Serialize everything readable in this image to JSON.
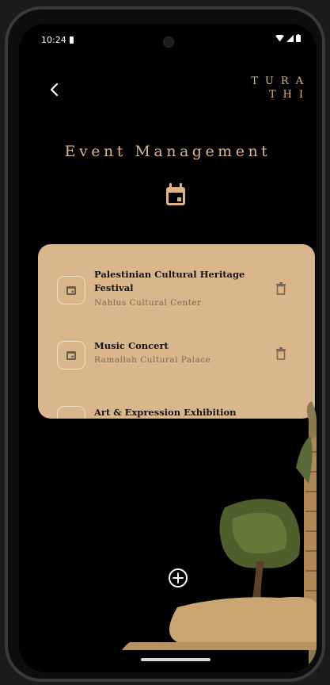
{
  "status_bar": {
    "time": "10:24"
  },
  "header": {
    "brand_line1": "TURA",
    "brand_line2": "THI"
  },
  "page": {
    "title": "Event Management"
  },
  "events": [
    {
      "title": "Palestinian Cultural Heritage Festival",
      "location": "Nahlus Cultural Center"
    },
    {
      "title": "Music Concert",
      "location": "Ramallah Cultural Palace"
    },
    {
      "title": "Art & Expression Exhibition",
      "location": ""
    }
  ],
  "colors": {
    "accent": "#ddb48a",
    "card": "#dab68d",
    "background": "#000000"
  },
  "icons": {
    "back": "chevron-left-icon",
    "calendar": "calendar-icon",
    "delete": "trash-icon",
    "add": "add-circle-icon"
  }
}
